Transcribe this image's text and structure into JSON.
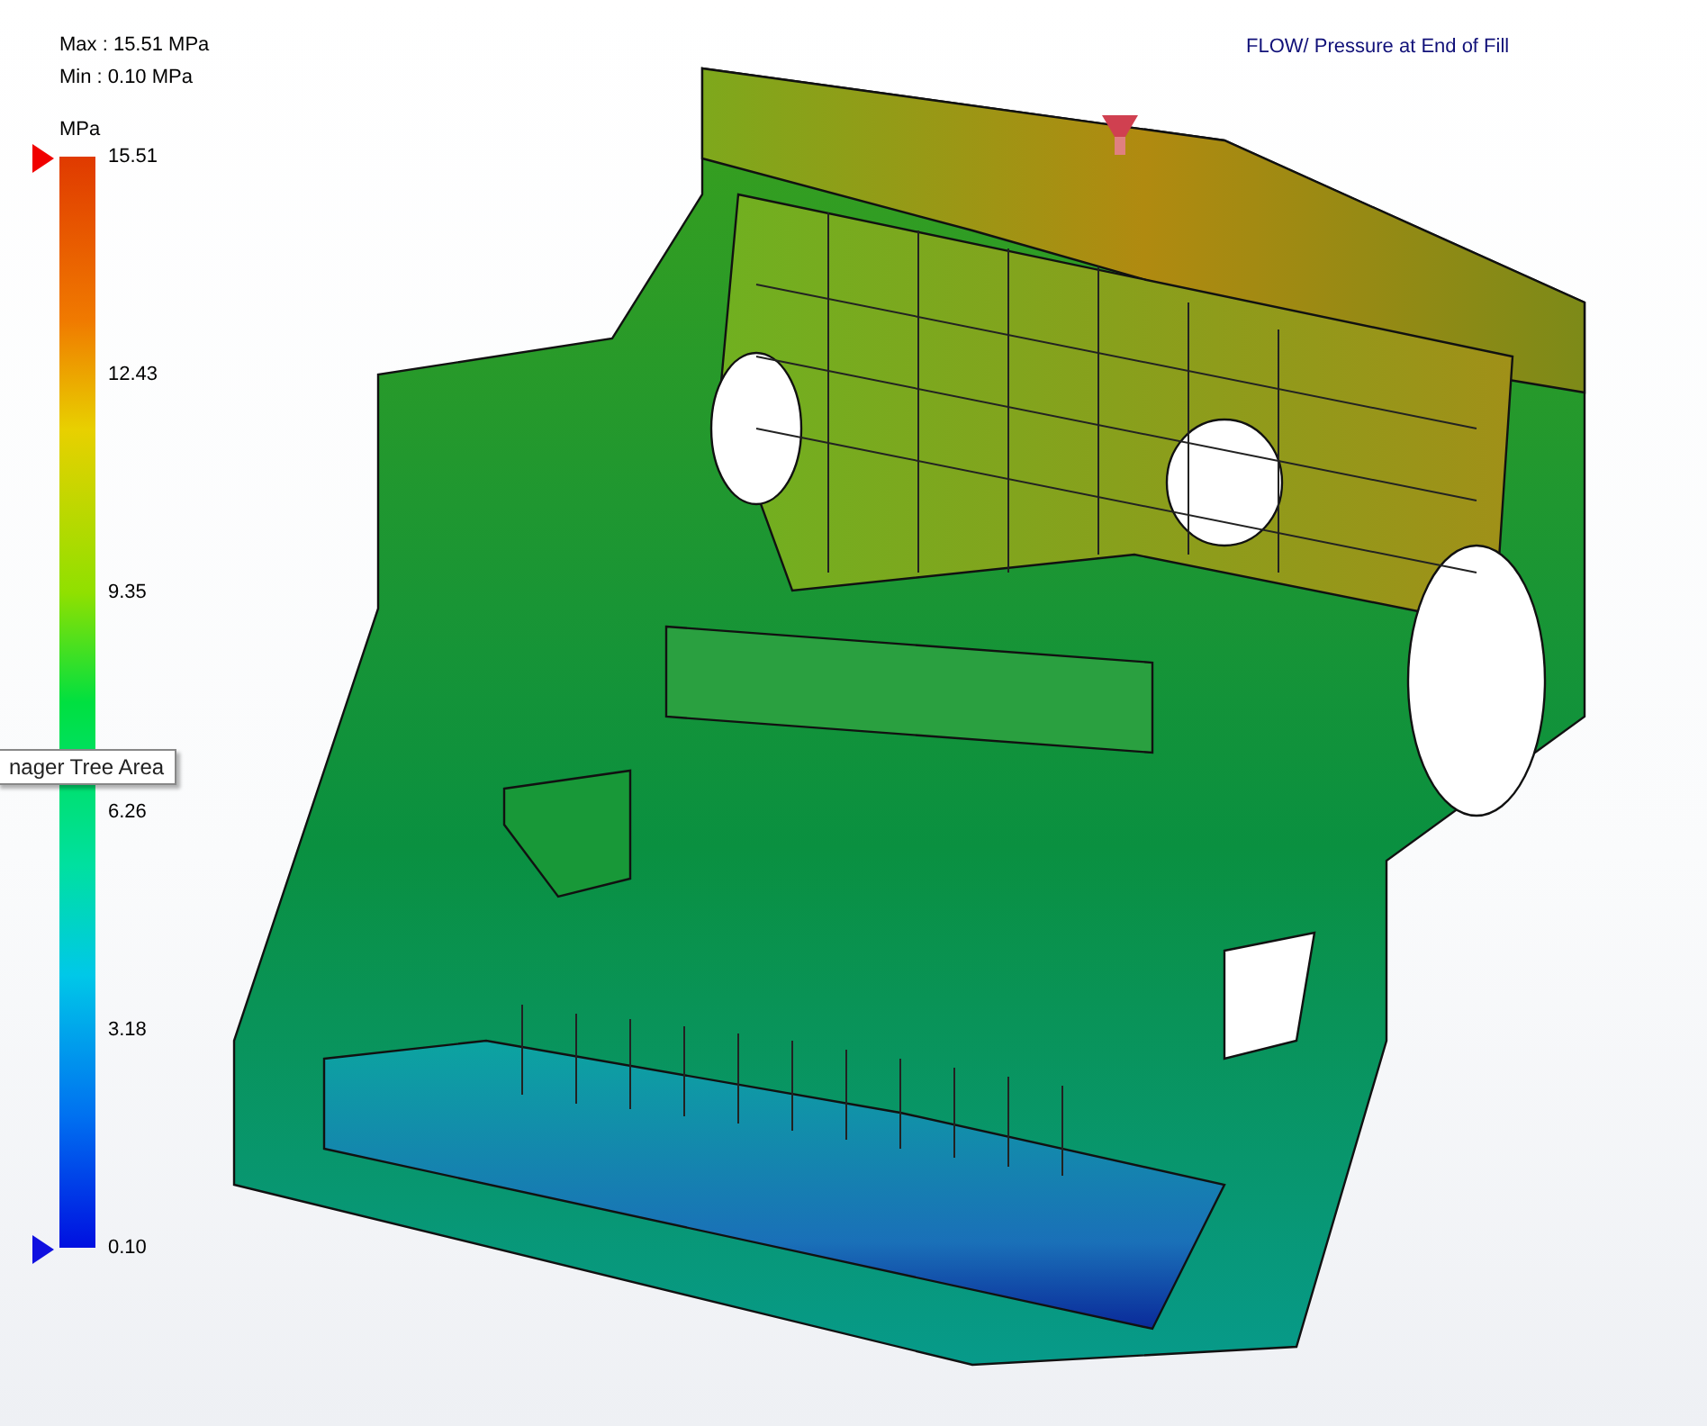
{
  "legend": {
    "max": "Max : 15.51 MPa",
    "min": "Min : 0.10 MPa",
    "unit": "MPa",
    "ticks": [
      "15.51",
      "12.43",
      "9.35",
      "6.26",
      "3.18",
      "0.10"
    ]
  },
  "plot_title": "FLOW/ Pressure at End of Fill",
  "tooltip": "nager Tree Area"
}
